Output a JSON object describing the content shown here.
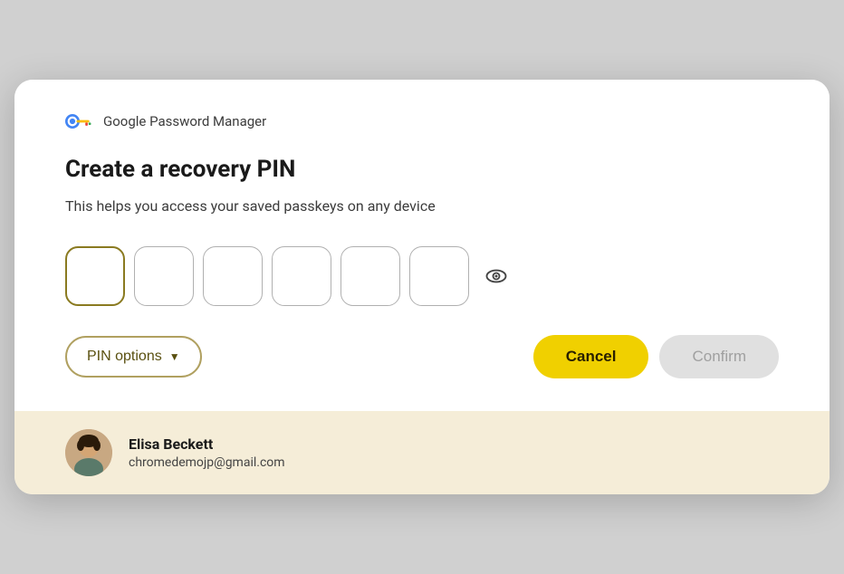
{
  "header": {
    "app_name": "Google Password Manager"
  },
  "dialog": {
    "title": "Create a recovery PIN",
    "subtitle": "This helps you access your saved passkeys on any device",
    "pin_boxes": [
      "",
      "",
      "",
      "",
      "",
      ""
    ],
    "pin_options_label": "PIN options",
    "cancel_label": "Cancel",
    "confirm_label": "Confirm"
  },
  "account": {
    "name": "Elisa Beckett",
    "email": "chromedemojp@gmail.com"
  },
  "icons": {
    "eye": "eye-icon",
    "chevron": "▼",
    "key_color_circle": "#4285F4",
    "key_color_body": "#FBBC05",
    "key_color_bit": "#EA4335"
  }
}
